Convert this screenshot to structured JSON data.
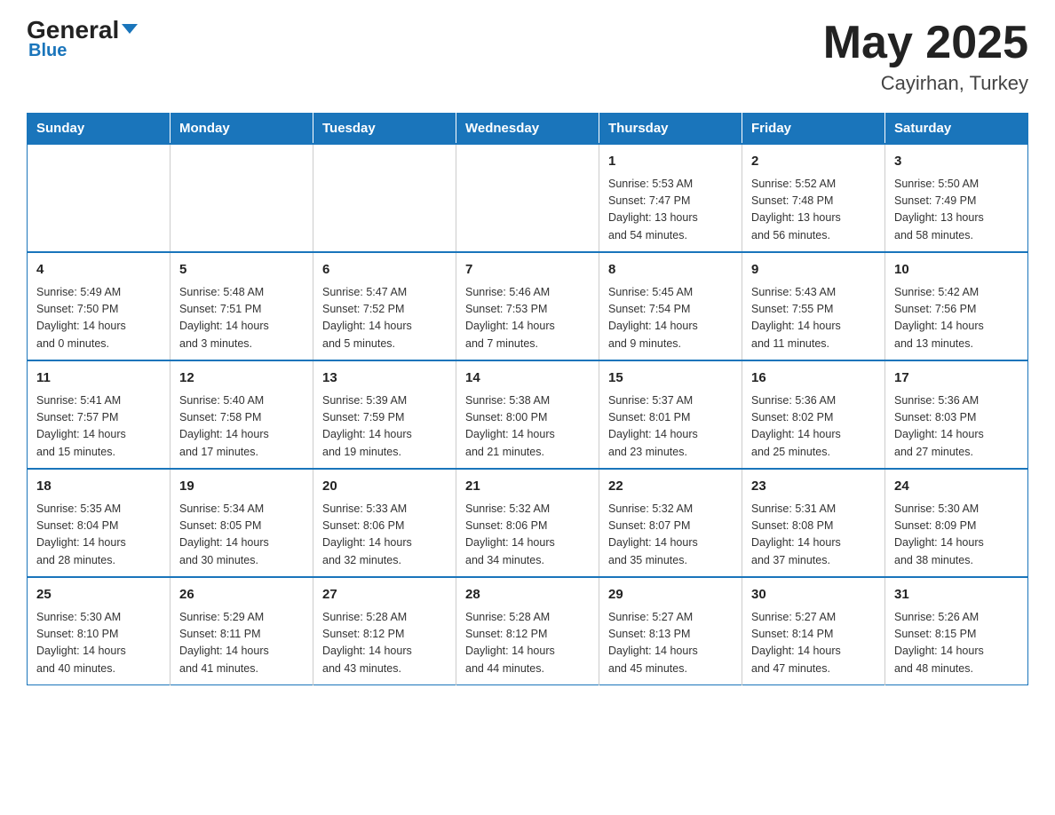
{
  "header": {
    "logo_main": "General",
    "logo_arrow": "▼",
    "logo_sub": "Blue",
    "title": "May 2025",
    "location": "Cayirhan, Turkey"
  },
  "calendar": {
    "days_of_week": [
      "Sunday",
      "Monday",
      "Tuesday",
      "Wednesday",
      "Thursday",
      "Friday",
      "Saturday"
    ],
    "weeks": [
      [
        {
          "day": "",
          "info": ""
        },
        {
          "day": "",
          "info": ""
        },
        {
          "day": "",
          "info": ""
        },
        {
          "day": "",
          "info": ""
        },
        {
          "day": "1",
          "info": "Sunrise: 5:53 AM\nSunset: 7:47 PM\nDaylight: 13 hours\nand 54 minutes."
        },
        {
          "day": "2",
          "info": "Sunrise: 5:52 AM\nSunset: 7:48 PM\nDaylight: 13 hours\nand 56 minutes."
        },
        {
          "day": "3",
          "info": "Sunrise: 5:50 AM\nSunset: 7:49 PM\nDaylight: 13 hours\nand 58 minutes."
        }
      ],
      [
        {
          "day": "4",
          "info": "Sunrise: 5:49 AM\nSunset: 7:50 PM\nDaylight: 14 hours\nand 0 minutes."
        },
        {
          "day": "5",
          "info": "Sunrise: 5:48 AM\nSunset: 7:51 PM\nDaylight: 14 hours\nand 3 minutes."
        },
        {
          "day": "6",
          "info": "Sunrise: 5:47 AM\nSunset: 7:52 PM\nDaylight: 14 hours\nand 5 minutes."
        },
        {
          "day": "7",
          "info": "Sunrise: 5:46 AM\nSunset: 7:53 PM\nDaylight: 14 hours\nand 7 minutes."
        },
        {
          "day": "8",
          "info": "Sunrise: 5:45 AM\nSunset: 7:54 PM\nDaylight: 14 hours\nand 9 minutes."
        },
        {
          "day": "9",
          "info": "Sunrise: 5:43 AM\nSunset: 7:55 PM\nDaylight: 14 hours\nand 11 minutes."
        },
        {
          "day": "10",
          "info": "Sunrise: 5:42 AM\nSunset: 7:56 PM\nDaylight: 14 hours\nand 13 minutes."
        }
      ],
      [
        {
          "day": "11",
          "info": "Sunrise: 5:41 AM\nSunset: 7:57 PM\nDaylight: 14 hours\nand 15 minutes."
        },
        {
          "day": "12",
          "info": "Sunrise: 5:40 AM\nSunset: 7:58 PM\nDaylight: 14 hours\nand 17 minutes."
        },
        {
          "day": "13",
          "info": "Sunrise: 5:39 AM\nSunset: 7:59 PM\nDaylight: 14 hours\nand 19 minutes."
        },
        {
          "day": "14",
          "info": "Sunrise: 5:38 AM\nSunset: 8:00 PM\nDaylight: 14 hours\nand 21 minutes."
        },
        {
          "day": "15",
          "info": "Sunrise: 5:37 AM\nSunset: 8:01 PM\nDaylight: 14 hours\nand 23 minutes."
        },
        {
          "day": "16",
          "info": "Sunrise: 5:36 AM\nSunset: 8:02 PM\nDaylight: 14 hours\nand 25 minutes."
        },
        {
          "day": "17",
          "info": "Sunrise: 5:36 AM\nSunset: 8:03 PM\nDaylight: 14 hours\nand 27 minutes."
        }
      ],
      [
        {
          "day": "18",
          "info": "Sunrise: 5:35 AM\nSunset: 8:04 PM\nDaylight: 14 hours\nand 28 minutes."
        },
        {
          "day": "19",
          "info": "Sunrise: 5:34 AM\nSunset: 8:05 PM\nDaylight: 14 hours\nand 30 minutes."
        },
        {
          "day": "20",
          "info": "Sunrise: 5:33 AM\nSunset: 8:06 PM\nDaylight: 14 hours\nand 32 minutes."
        },
        {
          "day": "21",
          "info": "Sunrise: 5:32 AM\nSunset: 8:06 PM\nDaylight: 14 hours\nand 34 minutes."
        },
        {
          "day": "22",
          "info": "Sunrise: 5:32 AM\nSunset: 8:07 PM\nDaylight: 14 hours\nand 35 minutes."
        },
        {
          "day": "23",
          "info": "Sunrise: 5:31 AM\nSunset: 8:08 PM\nDaylight: 14 hours\nand 37 minutes."
        },
        {
          "day": "24",
          "info": "Sunrise: 5:30 AM\nSunset: 8:09 PM\nDaylight: 14 hours\nand 38 minutes."
        }
      ],
      [
        {
          "day": "25",
          "info": "Sunrise: 5:30 AM\nSunset: 8:10 PM\nDaylight: 14 hours\nand 40 minutes."
        },
        {
          "day": "26",
          "info": "Sunrise: 5:29 AM\nSunset: 8:11 PM\nDaylight: 14 hours\nand 41 minutes."
        },
        {
          "day": "27",
          "info": "Sunrise: 5:28 AM\nSunset: 8:12 PM\nDaylight: 14 hours\nand 43 minutes."
        },
        {
          "day": "28",
          "info": "Sunrise: 5:28 AM\nSunset: 8:12 PM\nDaylight: 14 hours\nand 44 minutes."
        },
        {
          "day": "29",
          "info": "Sunrise: 5:27 AM\nSunset: 8:13 PM\nDaylight: 14 hours\nand 45 minutes."
        },
        {
          "day": "30",
          "info": "Sunrise: 5:27 AM\nSunset: 8:14 PM\nDaylight: 14 hours\nand 47 minutes."
        },
        {
          "day": "31",
          "info": "Sunrise: 5:26 AM\nSunset: 8:15 PM\nDaylight: 14 hours\nand 48 minutes."
        }
      ]
    ]
  }
}
